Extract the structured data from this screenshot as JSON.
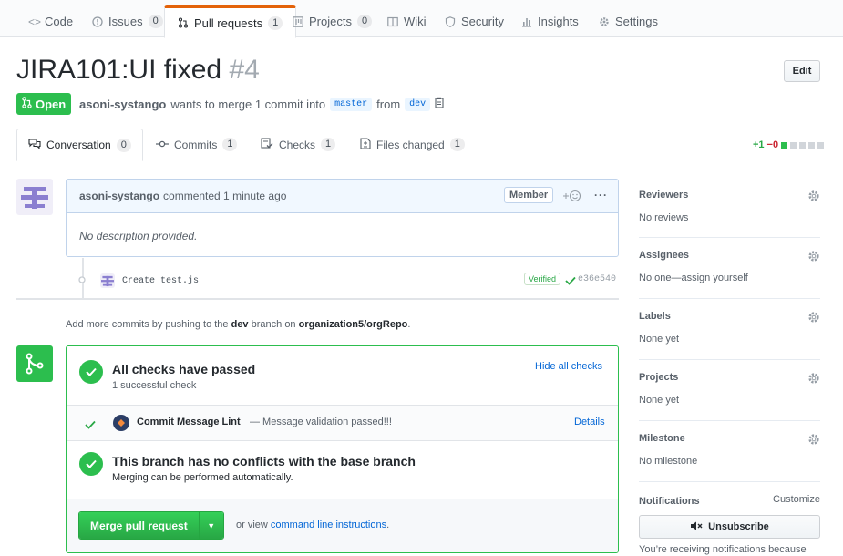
{
  "repo_nav": {
    "tabs": [
      {
        "label": "Code",
        "icon": "code-icon",
        "count": null
      },
      {
        "label": "Issues",
        "icon": "issue-icon",
        "count": "0"
      },
      {
        "label": "Pull requests",
        "icon": "pull-request-icon",
        "count": "1"
      },
      {
        "label": "Projects",
        "icon": "project-icon",
        "count": "0"
      },
      {
        "label": "Wiki",
        "icon": "book-icon",
        "count": null
      },
      {
        "label": "Security",
        "icon": "shield-icon",
        "count": null
      },
      {
        "label": "Insights",
        "icon": "graph-icon",
        "count": null
      },
      {
        "label": "Settings",
        "icon": "gear-icon",
        "count": null
      }
    ]
  },
  "pr": {
    "title": "JIRA101:UI fixed",
    "number": "#4",
    "edit_label": "Edit",
    "state": "Open",
    "author": "asoni-systango",
    "merge_text": "wants to merge 1 commit into",
    "base_branch": "master",
    "from_text": "from",
    "head_branch": "dev"
  },
  "pr_tabs": [
    {
      "label": "Conversation",
      "count": "0",
      "icon": "comment-discussion-icon"
    },
    {
      "label": "Commits",
      "count": "1",
      "icon": "commit-icon"
    },
    {
      "label": "Checks",
      "count": "1",
      "icon": "checklist-icon"
    },
    {
      "label": "Files changed",
      "count": "1",
      "icon": "file-diff-icon"
    }
  ],
  "diffstat": {
    "additions": "+1",
    "deletions": "−0"
  },
  "comment": {
    "author": "asoni-systango",
    "time_text": "commented 1 minute ago",
    "role": "Member",
    "body": "No description provided."
  },
  "commit": {
    "message": "Create test.js",
    "verified": "Verified",
    "sha": "e36e540"
  },
  "push_note": {
    "prefix": "Add more commits by pushing to the",
    "branch": "dev",
    "middle": "branch on",
    "repo": "organization5/orgRepo",
    "suffix": "."
  },
  "merge_box": {
    "checks_title": "All checks have passed",
    "checks_sub": "1 successful check",
    "hide_checks": "Hide all checks",
    "check_name": "Commit Message Lint",
    "check_desc": "— Message validation passed!!!",
    "details": "Details",
    "conflict_title": "This branch has no conflicts with the base branch",
    "conflict_sub": "Merging can be performed automatically.",
    "merge_button": "Merge pull request",
    "or_view": "or view",
    "cli_link": "command line instructions",
    "cli_suffix": "."
  },
  "sidebar": {
    "reviewers": {
      "heading": "Reviewers",
      "value": "No reviews"
    },
    "assignees": {
      "heading": "Assignees",
      "value": "No one—assign yourself"
    },
    "labels": {
      "heading": "Labels",
      "value": "None yet"
    },
    "projects": {
      "heading": "Projects",
      "value": "None yet"
    },
    "milestone": {
      "heading": "Milestone",
      "value": "No milestone"
    },
    "notifications": {
      "heading": "Notifications",
      "customize": "Customize",
      "unsubscribe": "Unsubscribe",
      "note": "You’re receiving notifications because"
    }
  },
  "colors": {
    "accent": "#0366d6",
    "success": "#2cbe4e",
    "tab_active": "#e36209"
  }
}
